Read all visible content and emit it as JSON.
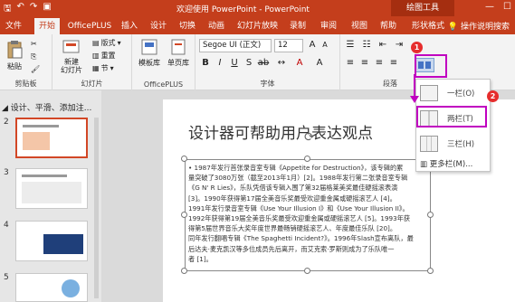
{
  "titlebar": {
    "title": "欢迎使用 PowerPoint  -  PowerPoint",
    "context_tab": "绘图工具",
    "qat_icons": [
      "save-icon",
      "undo-icon",
      "redo-icon",
      "present-icon"
    ],
    "minimize": "—",
    "maximize": "☐",
    "close": "✕"
  },
  "tabs": [
    {
      "label": "文件"
    },
    {
      "label": "开始"
    },
    {
      "label": "OfficePLUS"
    },
    {
      "label": "插入"
    },
    {
      "label": "设计"
    },
    {
      "label": "切换"
    },
    {
      "label": "动画"
    },
    {
      "label": "幻灯片放映"
    },
    {
      "label": "录制"
    },
    {
      "label": "审阅"
    },
    {
      "label": "视图"
    },
    {
      "label": "帮助"
    },
    {
      "label": "形状格式"
    }
  ],
  "help_search": "操作说明搜索",
  "ribbon": {
    "clipboard": {
      "paste": "粘贴",
      "label": "剪贴板"
    },
    "slides": {
      "new_slide": "新建\n幻灯片",
      "layout": "版式",
      "reset": "重置",
      "section": "节",
      "label": "幻灯片"
    },
    "officeplus": {
      "template": "模板库",
      "single_page": "单页库",
      "label": "OfficePLUS"
    },
    "font": {
      "family": "Segoe UI (正文)",
      "size": "12",
      "label": "字体"
    },
    "paragraph": {
      "label": "段落"
    }
  },
  "outline_text": "设计、平滑、添加注...",
  "slides": [
    {
      "num": "2"
    },
    {
      "num": "3"
    },
    {
      "num": "4"
    },
    {
      "num": "5"
    }
  ],
  "slide": {
    "title": "设计器可帮助用户表达观点",
    "body_lines": [
      "• 1987年发行首张录音室专辑《Appetite for Destruction》，该专辑的累",
      "量突破了3080万张（截至2013年1月）[2]。1988年发行第二张录音室专辑",
      "《G N' R Lies》，乐队凭借该专辑入围了第32届格莱美奖最佳硬摇滚表演",
      "[3]。1990年获得第17届全美音乐奖最受欢迎重金属或硬摇滚艺人 [4]。",
      "1991年发行录音室专辑《Use Your Illusion I》和《Use Your Illusion II》。",
      "1992年获得第19届全美音乐奖最受欢迎重金属或硬摇滚艺人 [5]。1993年获",
      "得第5届世界音乐大奖年度世界最畅销硬摇滚艺人、年度最佳乐队 [20]。",
      "同年发行翻唱专辑《The Spaghetti Incident?》。1996年Slash宣布离队，最",
      "后达夫·麦克凯汉等多位成员先后离开，而艾克索·罗斯则成为了乐队唯一",
      "者 [1]。"
    ]
  },
  "columns_menu": {
    "items": [
      {
        "label": "一栏(O)"
      },
      {
        "label": "两栏(T)"
      },
      {
        "label": "三栏(H)"
      }
    ],
    "more": "更多栏(M)..."
  },
  "steps": [
    "1",
    "2"
  ],
  "colors": {
    "accent": "#c43e1c",
    "highlight": "#c000c0",
    "step": "#e62d2d"
  }
}
